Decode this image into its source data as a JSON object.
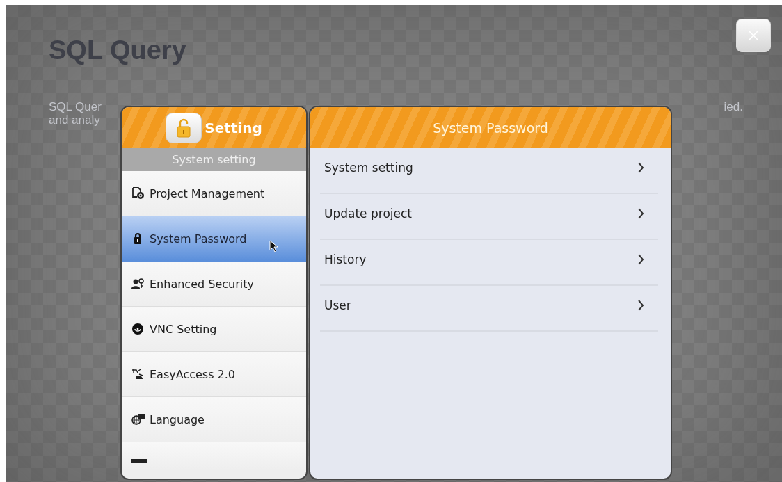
{
  "background": {
    "title": "SQL Query",
    "fragments_left": [
      "SQL Quer",
      "and analy"
    ],
    "fragment_right": "ied."
  },
  "sidebar": {
    "title": "Setting",
    "section": "System setting",
    "items": [
      {
        "label": "Project Management",
        "kind": "project",
        "selected": false
      },
      {
        "label": "System Password",
        "kind": "lock",
        "selected": true
      },
      {
        "label": "Enhanced Security",
        "kind": "users",
        "selected": false
      },
      {
        "label": "VNC Setting",
        "kind": "vnc",
        "selected": false
      },
      {
        "label": "EasyAccess 2.0",
        "kind": "access",
        "selected": false
      },
      {
        "label": "Language",
        "kind": "language",
        "selected": false
      }
    ]
  },
  "panel": {
    "title": "System Password",
    "rows": [
      {
        "label": "System setting"
      },
      {
        "label": "Update project"
      },
      {
        "label": "History"
      },
      {
        "label": "User"
      }
    ]
  }
}
